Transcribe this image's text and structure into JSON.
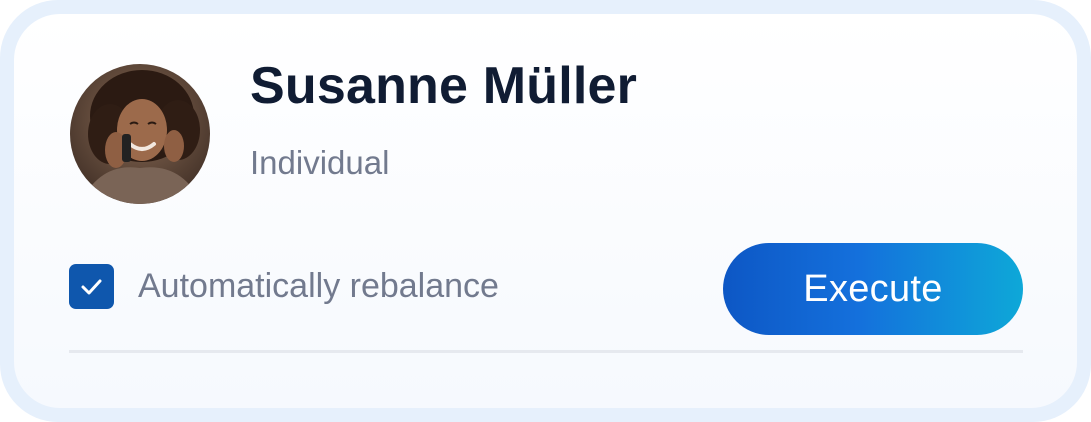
{
  "profile": {
    "name": "Susanne Müller",
    "account_type": "Individual",
    "avatar_icon": "person-photo"
  },
  "rebalance": {
    "label": "Automatically rebalance",
    "checked": true
  },
  "actions": {
    "execute_label": "Execute"
  },
  "colors": {
    "accent": "#0f57ad",
    "button_gradient_start": "#0d57c5",
    "button_gradient_end": "#0ea8d8",
    "name_text": "#101c33",
    "secondary_text": "#727a8e",
    "card_border": "#e6f0fc"
  }
}
